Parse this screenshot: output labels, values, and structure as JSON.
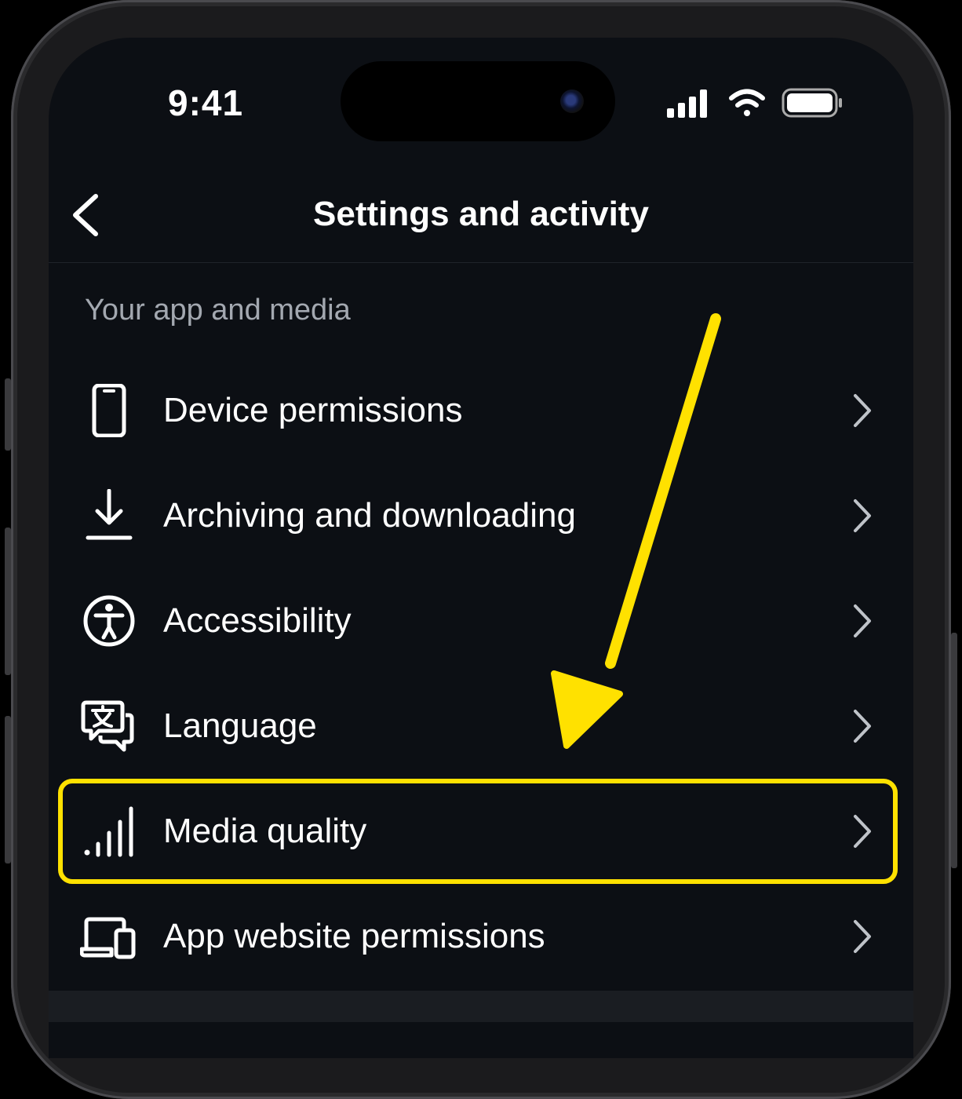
{
  "status_bar": {
    "time": "9:41",
    "signal_icon": "cellular-signal-icon",
    "wifi_icon": "wifi-icon",
    "battery_icon": "battery-icon"
  },
  "nav": {
    "back_icon": "chevron-left-icon",
    "title": "Settings and activity"
  },
  "section": {
    "header": "Your app and media",
    "items": [
      {
        "label": "Device permissions",
        "icon": "phone-device-icon"
      },
      {
        "label": "Archiving and downloading",
        "icon": "download-icon"
      },
      {
        "label": "Accessibility",
        "icon": "accessibility-icon"
      },
      {
        "label": "Language",
        "icon": "translate-icon"
      },
      {
        "label": "Media quality",
        "icon": "signal-bars-icon",
        "highlighted": true
      },
      {
        "label": "App website permissions",
        "icon": "laptop-phone-icon"
      }
    ]
  },
  "colors": {
    "background": "#0c0f14",
    "text": "#ffffff",
    "section_header": "#a3a8b0",
    "annotation": "#ffe100"
  }
}
